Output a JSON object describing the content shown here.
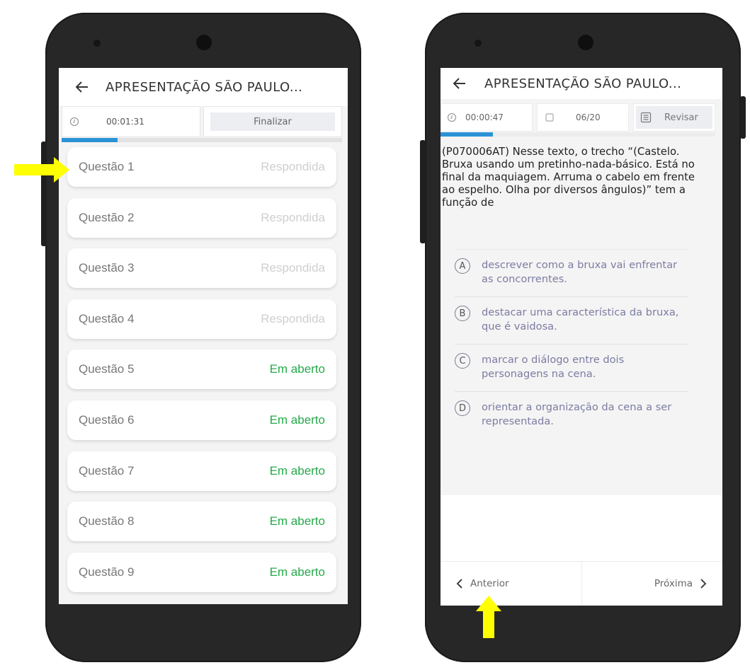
{
  "left_screen": {
    "title": "APRESENTAÇÃO SÃO PAULO...",
    "timer": "00:01:31",
    "finalize_label": "Finalizar",
    "progress": 0.2,
    "questions": [
      {
        "name": "Questão 1",
        "status": "Respondida"
      },
      {
        "name": "Questão 2",
        "status": "Respondida"
      },
      {
        "name": "Questão 3",
        "status": "Respondida"
      },
      {
        "name": "Questão 4",
        "status": "Respondida"
      },
      {
        "name": "Questão 5",
        "status": "Em aberto"
      },
      {
        "name": "Questão 6",
        "status": "Em aberto"
      },
      {
        "name": "Questão 7",
        "status": "Em aberto"
      },
      {
        "name": "Questão 8",
        "status": "Em aberto"
      },
      {
        "name": "Questão 9",
        "status": "Em aberto"
      }
    ]
  },
  "right_screen": {
    "title": "APRESENTAÇÃO SÃO PAULO...",
    "timer": "00:00:47",
    "counter": "06/20",
    "review_label": "Revisar",
    "progress": 0.19,
    "question_text": "(P070006AT) Nesse texto, o trecho “(Castelo. Bruxa usando um pretinho-nada-básico. Está no final da maquiagem. Arruma o cabelo em frente ao espelho. Olha por diversos ângulos)” tem a função de",
    "alternatives": [
      {
        "letter": "A",
        "text": "descrever como a bruxa vai enfrentar as concorrentes."
      },
      {
        "letter": "B",
        "text": "destacar uma característica da bruxa, que é vaidosa."
      },
      {
        "letter": "C",
        "text": "marcar o diálogo entre dois personagens na cena."
      },
      {
        "letter": "D",
        "text": "orientar a organização da cena a ser representada."
      }
    ],
    "prev_label": "Anterior",
    "next_label": "Próxima"
  },
  "colors": {
    "accent_blue": "#2b92d6",
    "open_green": "#25a94a",
    "indicator_yellow": "#ffff00"
  },
  "icons": [
    "back-arrow-icon",
    "clock-icon",
    "page-icon",
    "review-list-icon",
    "chevron-left-icon",
    "chevron-right-icon",
    "pointer-arrow-icon"
  ]
}
